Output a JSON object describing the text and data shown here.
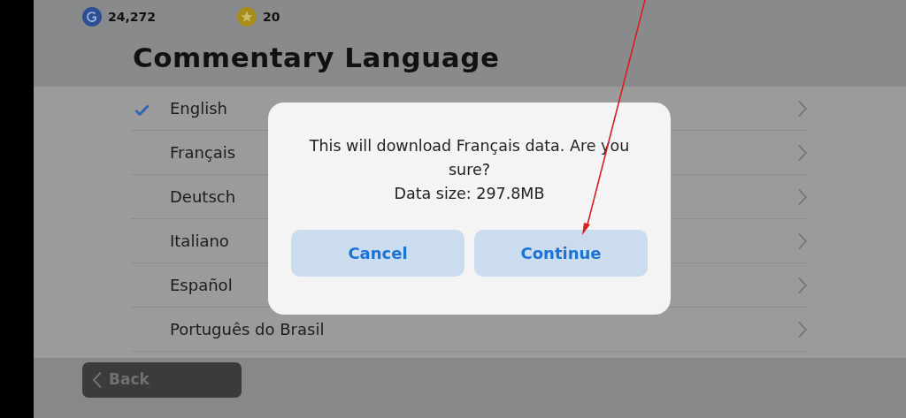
{
  "currencies": [
    {
      "kind": "gp",
      "amount": "24,272"
    },
    {
      "kind": "coin",
      "amount": "20"
    }
  ],
  "title": "Commentary Language",
  "languages": [
    {
      "label": "English",
      "selected": true
    },
    {
      "label": "Français",
      "selected": false
    },
    {
      "label": "Deutsch",
      "selected": false
    },
    {
      "label": "Italiano",
      "selected": false
    },
    {
      "label": "Español",
      "selected": false
    },
    {
      "label": "Português do Brasil",
      "selected": false
    }
  ],
  "dialog": {
    "message": "This will download Français data. Are you sure?",
    "detail": "Data size: 297.8MB",
    "buttons": [
      "Cancel",
      "Continue"
    ]
  },
  "back_button": "Back"
}
